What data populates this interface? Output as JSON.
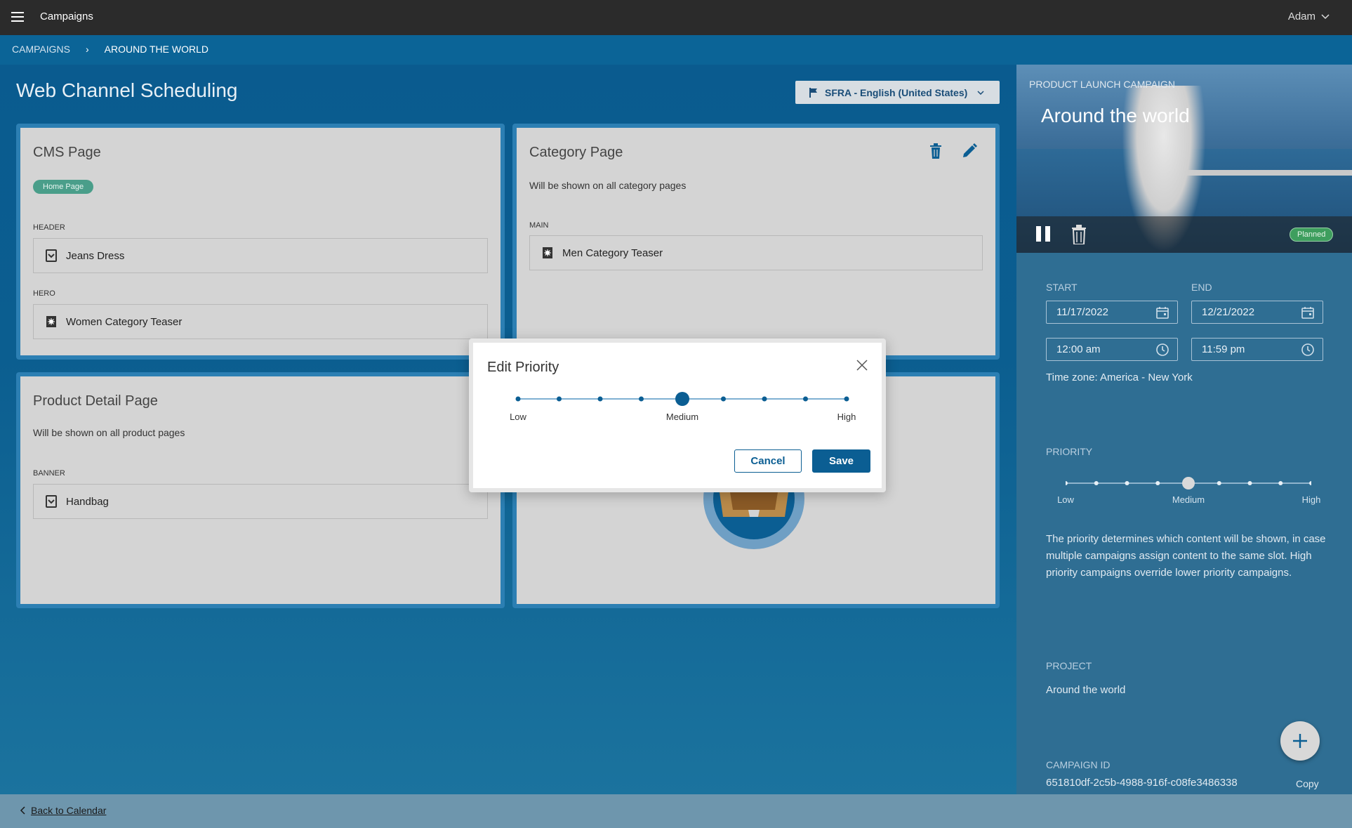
{
  "topbar": {
    "app_title": "Campaigns",
    "user_name": "Adam"
  },
  "breadcrumb": {
    "parent": "CAMPAIGNS",
    "separator": "›",
    "current": "AROUND THE WORLD"
  },
  "page": {
    "title": "Web Channel Scheduling",
    "locale_label": "SFRA - English (United States)"
  },
  "cards": {
    "cms": {
      "title": "CMS Page",
      "badge": "Home Page",
      "slots": [
        {
          "label": "HEADER",
          "value": "Jeans Dress",
          "icon": "content-asset-icon"
        },
        {
          "label": "HERO",
          "value": "Women Category Teaser",
          "icon": "category-teaser-icon"
        }
      ]
    },
    "category": {
      "title": "Category Page",
      "description": "Will be shown on all category pages",
      "slots": [
        {
          "label": "MAIN",
          "value": "Men Category Teaser",
          "icon": "category-teaser-icon"
        }
      ]
    },
    "product": {
      "title": "Product Detail Page",
      "description": "Will be shown on all product pages",
      "slots": [
        {
          "label": "BANNER",
          "value": "Handbag",
          "icon": "content-asset-icon"
        }
      ]
    }
  },
  "side": {
    "eyebrow": "PRODUCT LAUNCH CAMPAIGN",
    "title": "Around the world",
    "status": "Planned",
    "start_label": "START",
    "end_label": "END",
    "start_date": "11/17/2022",
    "end_date": "12/21/2022",
    "start_time": "12:00 am",
    "end_time": "11:59 pm",
    "timezone": "Time zone: America - New York",
    "priority_label": "PRIORITY",
    "priority": {
      "low": "Low",
      "medium": "Medium",
      "high": "High",
      "steps": 9,
      "selected_index": 4
    },
    "help": "The priority determines which content will be shown, in case multiple campaigns assign content to the same slot. High priority campaigns override lower priority campaigns.",
    "project_label": "PROJECT",
    "project_value": "Around the world",
    "campaign_id_label": "CAMPAIGN ID",
    "campaign_id": "651810df-2c5b-4988-916f-c08fe3486338",
    "copy_label": "Copy"
  },
  "modal": {
    "title": "Edit Priority",
    "priority": {
      "low": "Low",
      "medium": "Medium",
      "high": "High",
      "steps": 9,
      "selected_index": 4
    },
    "cancel_label": "Cancel",
    "save_label": "Save"
  },
  "footer": {
    "back_label": "Back to Calendar"
  },
  "colors": {
    "primary": "#0b5e93",
    "topbar": "#2b2b2b",
    "badge_green": "#4a9e8a",
    "planned_green": "#3e9e5e"
  }
}
